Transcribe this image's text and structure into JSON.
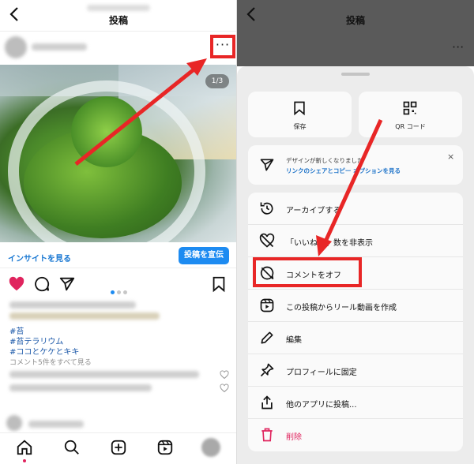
{
  "left": {
    "header": {
      "title": "投稿"
    },
    "more_glyph": "···",
    "photo_pager": "1/3",
    "insight_label": "インサイトを見る",
    "promote_label": "投稿を宣伝",
    "hashtags": [
      "#苔",
      "#苔テラリウム",
      "#ココとケケとキキ"
    ],
    "view_comments": "コメント5件をすべて見る",
    "carousel_dots": 3,
    "active_dot": 1
  },
  "right": {
    "header": {
      "title": "投稿"
    },
    "tiles": [
      {
        "icon": "bookmark-icon",
        "label": "保存"
      },
      {
        "icon": "qr-code-icon",
        "label": "QR コード"
      }
    ],
    "notice": {
      "line1": "デザインが新しくなりました",
      "line2": "リンクのシェアとコピー オプションを見る",
      "close": "×"
    },
    "menu": [
      {
        "icon": "archive-icon",
        "label": "アーカイブする"
      },
      {
        "icon": "hide-likes-icon",
        "label": "「いいね！」数を非表示"
      },
      {
        "icon": "comments-off-icon",
        "label": "コメントをオフ"
      },
      {
        "icon": "reel-icon",
        "label": "この投稿からリール動画を作成"
      },
      {
        "icon": "edit-icon",
        "label": "編集"
      },
      {
        "icon": "pin-icon",
        "label": "プロフィールに固定"
      },
      {
        "icon": "share-icon",
        "label": "他のアプリに投稿..."
      },
      {
        "icon": "trash-icon",
        "label": "削除",
        "danger": true
      }
    ]
  },
  "colors": {
    "accent": "#1d8bf1",
    "highlight": "#e82626",
    "danger": "#e0245e",
    "like": "#e0245e"
  }
}
